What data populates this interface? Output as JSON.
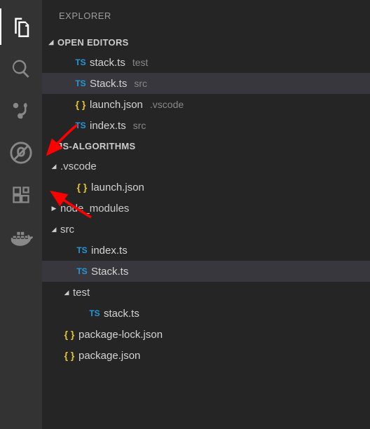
{
  "sidebar_title": "EXPLORER",
  "open_editors_label": "OPEN EDITORS",
  "project_label": "JS-ALGORITHMS",
  "icons": {
    "ts": "TS",
    "json": "{ }"
  },
  "open_editors": [
    {
      "icon": "ts",
      "name": "stack.ts",
      "dir": "test"
    },
    {
      "icon": "ts",
      "name": "Stack.ts",
      "dir": "src",
      "selected": true
    },
    {
      "icon": "json",
      "name": "launch.json",
      "dir": ".vscode"
    },
    {
      "icon": "ts",
      "name": "index.ts",
      "dir": "src"
    }
  ],
  "tree": [
    {
      "type": "folder",
      "depth": 0,
      "expanded": true,
      "name": ".vscode"
    },
    {
      "type": "file",
      "depth": 1,
      "icon": "json",
      "name": "launch.json"
    },
    {
      "type": "folder",
      "depth": 0,
      "expanded": false,
      "name": "node_modules"
    },
    {
      "type": "folder",
      "depth": 0,
      "expanded": true,
      "name": "src"
    },
    {
      "type": "file",
      "depth": 1,
      "icon": "ts",
      "name": "index.ts"
    },
    {
      "type": "file",
      "depth": 1,
      "icon": "ts",
      "name": "Stack.ts",
      "selected": true
    },
    {
      "type": "folder",
      "depth": 1,
      "expanded": true,
      "name": "test"
    },
    {
      "type": "file",
      "depth": 2,
      "icon": "ts",
      "name": "stack.ts"
    },
    {
      "type": "file",
      "depth": 0,
      "icon": "json",
      "name": "package-lock.json"
    },
    {
      "type": "file",
      "depth": 0,
      "icon": "json",
      "name": "package.json"
    }
  ]
}
